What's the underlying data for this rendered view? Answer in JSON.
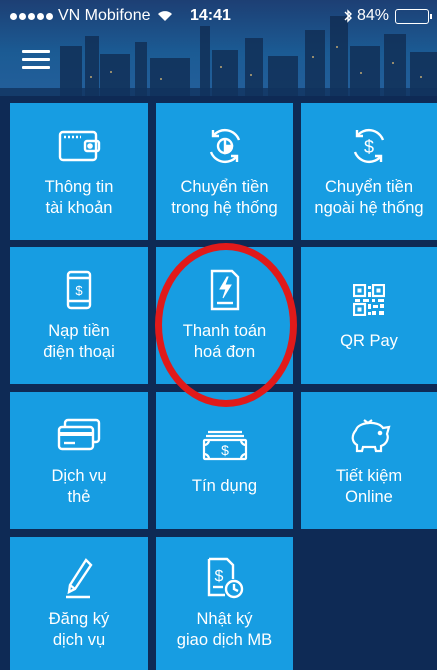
{
  "status_bar": {
    "carrier": "VN Mobifone",
    "time": "14:41",
    "battery": "84%",
    "battery_level": 0.84,
    "signal_dots": 5
  },
  "header": {
    "menu_icon": "hamburger-menu-icon"
  },
  "tiles": [
    {
      "label_line1": "Thông tin",
      "label_line2": "tài khoản",
      "icon": "wallet-icon"
    },
    {
      "label_line1": "Chuyển tiền",
      "label_line2": "trong hệ thống",
      "icon": "transfer-cycle-icon"
    },
    {
      "label_line1": "Chuyển tiền",
      "label_line2": "ngoài hệ thống",
      "icon": "dollar-cycle-icon"
    },
    {
      "label_line1": "Nạp tiền",
      "label_line2": "điện thoại",
      "icon": "phone-dollar-icon"
    },
    {
      "label_line1": "Thanh toán",
      "label_line2": "hoá đơn",
      "icon": "bill-bolt-icon"
    },
    {
      "label_line1": "QR Pay",
      "label_line2": "",
      "icon": "qr-code-icon"
    },
    {
      "label_line1": "Dịch vụ",
      "label_line2": "thẻ",
      "icon": "cards-icon"
    },
    {
      "label_line1": "Tín dụng",
      "label_line2": "",
      "icon": "banknote-icon"
    },
    {
      "label_line1": "Tiết kiệm",
      "label_line2": "Online",
      "icon": "piggy-bank-icon"
    },
    {
      "label_line1": "Đăng ký",
      "label_line2": "dịch vụ",
      "icon": "pen-icon"
    },
    {
      "label_line1": "Nhật ký",
      "label_line2": "giao dịch MB",
      "icon": "history-document-icon"
    }
  ],
  "colors": {
    "tile": "#179de2",
    "background": "#0e2a55",
    "highlight": "#e01a1a"
  }
}
